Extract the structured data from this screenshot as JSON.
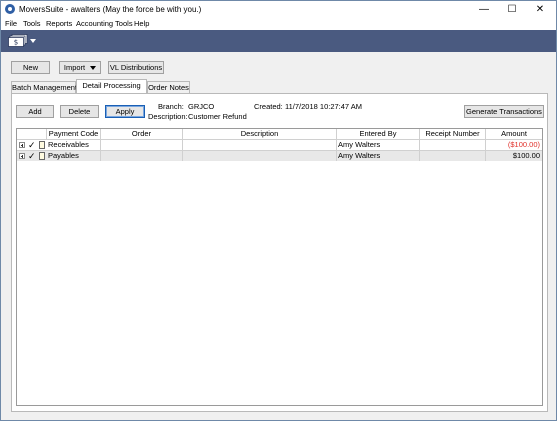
{
  "window": {
    "title": "MoversSuite - awalters (May the force be with you.)",
    "controls": {
      "minimize": "—",
      "maximize": "☐",
      "close": "✕"
    }
  },
  "menu": [
    "File",
    "Tools",
    "Reports",
    "Accounting Tools",
    "Help"
  ],
  "toolbar": {
    "new_label": "New",
    "import_label": "Import",
    "vl_label": "VL Distributions"
  },
  "tabs": [
    "Batch Management",
    "Detail Processing",
    "Order Notes"
  ],
  "actions": {
    "add_label": "Add",
    "delete_label": "Delete",
    "apply_label": "Apply",
    "generate_label": "Generate Transactions"
  },
  "details": {
    "branch_label": "Branch:",
    "branch_value": "GRJCO",
    "description_label": "Description:",
    "description_value": "Customer Refund",
    "created_label": "Created:",
    "created_value": "11/7/2018 10:27:47 AM"
  },
  "grid": {
    "columns": [
      "Payment Code",
      "Order",
      "Description",
      "Entered By",
      "Receipt Number",
      "Amount"
    ],
    "rows": [
      {
        "payment_code": "Receivables",
        "order": "",
        "description": "",
        "entered_by": "Amy Walters",
        "receipt_number": "",
        "amount": "($100.00)"
      },
      {
        "payment_code": "Payables",
        "order": "",
        "description": "",
        "entered_by": "Amy Walters",
        "receipt_number": "",
        "amount": "$100.00"
      }
    ]
  },
  "colors": {
    "toolbar_band": "#4a5a80",
    "negative_amount": "#e0302a"
  }
}
